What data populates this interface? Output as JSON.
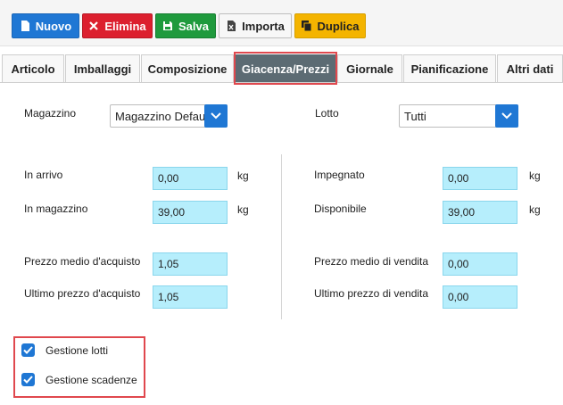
{
  "toolbar": {
    "new_label": "Nuovo",
    "delete_label": "Elimina",
    "save_label": "Salva",
    "import_label": "Importa",
    "duplicate_label": "Duplica"
  },
  "tabs": [
    {
      "label": "Articolo"
    },
    {
      "label": "Imballaggi"
    },
    {
      "label": "Composizione"
    },
    {
      "label": "Giacenza/Prezzi"
    },
    {
      "label": "Giornale"
    },
    {
      "label": "Pianificazione"
    },
    {
      "label": "Altri dati"
    }
  ],
  "form": {
    "magazzino_label": "Magazzino",
    "magazzino_value": "Magazzino Default",
    "lotto_label": "Lotto",
    "lotto_value": "Tutti",
    "in_arrivo_label": "In arrivo",
    "in_arrivo_value": "0,00",
    "in_arrivo_unit": "kg",
    "in_magazzino_label": "In magazzino",
    "in_magazzino_value": "39,00",
    "in_magazzino_unit": "kg",
    "impegnato_label": "Impegnato",
    "impegnato_value": "0,00",
    "impegnato_unit": "kg",
    "disponibile_label": "Disponibile",
    "disponibile_value": "39,00",
    "disponibile_unit": "kg",
    "prezzo_medio_acquisto_label": "Prezzo medio d'acquisto",
    "prezzo_medio_acquisto_value": "1,05",
    "ultimo_prezzo_acquisto_label": "Ultimo prezzo d'acquisto",
    "ultimo_prezzo_acquisto_value": "1,05",
    "prezzo_medio_vendita_label": "Prezzo medio di vendita",
    "prezzo_medio_vendita_value": "0,00",
    "ultimo_prezzo_vendita_label": "Ultimo prezzo di vendita",
    "ultimo_prezzo_vendita_value": "0,00"
  },
  "options": {
    "gestione_lotti_label": "Gestione lotti",
    "gestione_scadenze_label": "Gestione scadenze"
  },
  "colors": {
    "primary": "#1f77d4",
    "danger": "#dc1f2e",
    "success": "#1f9a3d",
    "warning": "#f4b400",
    "active_tab": "#5c6b73",
    "field_bg": "#b6eefc",
    "highlight": "#e0484e"
  },
  "icons": {
    "new": "document-icon",
    "delete": "close-icon",
    "save": "floppy-icon",
    "import": "excel-icon",
    "duplicate": "copy-icon"
  }
}
